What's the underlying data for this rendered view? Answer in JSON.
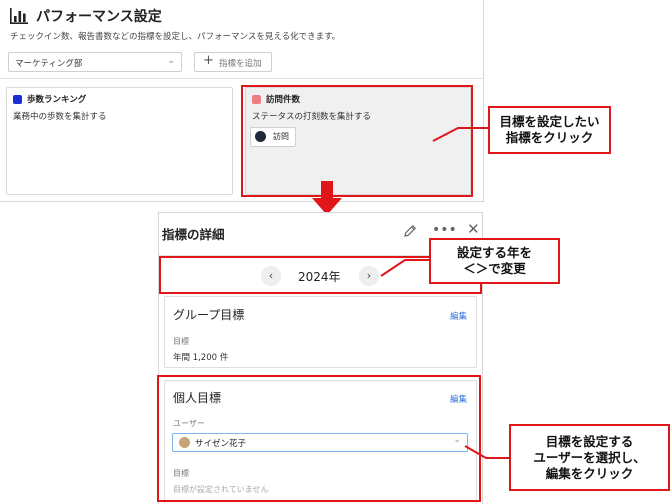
{
  "header": {
    "title": "パフォーマンス設定",
    "description": "チェックイン数、報告書数などの指標を設定し、パフォーマンスを見える化できます。"
  },
  "toolbar": {
    "department_select_value": "マーケティング部",
    "add_metric_label": "指標を追加"
  },
  "metrics": [
    {
      "title": "歩数ランキング",
      "description": "業務中の歩数を集計する",
      "color": "#1b2ed8"
    },
    {
      "title": "訪問件数",
      "description": "ステータスの打刻数を集計する",
      "color": "#ec7f7f",
      "tag": "訪問"
    }
  ],
  "detail": {
    "title": "指標の詳細",
    "year": "2024年",
    "group": {
      "title": "グループ目標",
      "edit_label": "編集",
      "target_label": "目標",
      "target_value": "年間 1,200 件"
    },
    "personal": {
      "title": "個人目標",
      "edit_label": "編集",
      "user_label": "ユーザー",
      "user_value": "サイゼン花子",
      "target_label": "目標",
      "target_placeholder": "目標が設定されていません"
    }
  },
  "annotations": {
    "callout_1": [
      "目標を設定したい",
      "指標をクリック"
    ],
    "callout_2": [
      "設定する年を",
      "＜＞で変更"
    ],
    "callout_3": [
      "目標を設定する",
      "ユーザーを選択し、",
      "編集をクリック"
    ],
    "highlight_color": "#e0161b"
  }
}
